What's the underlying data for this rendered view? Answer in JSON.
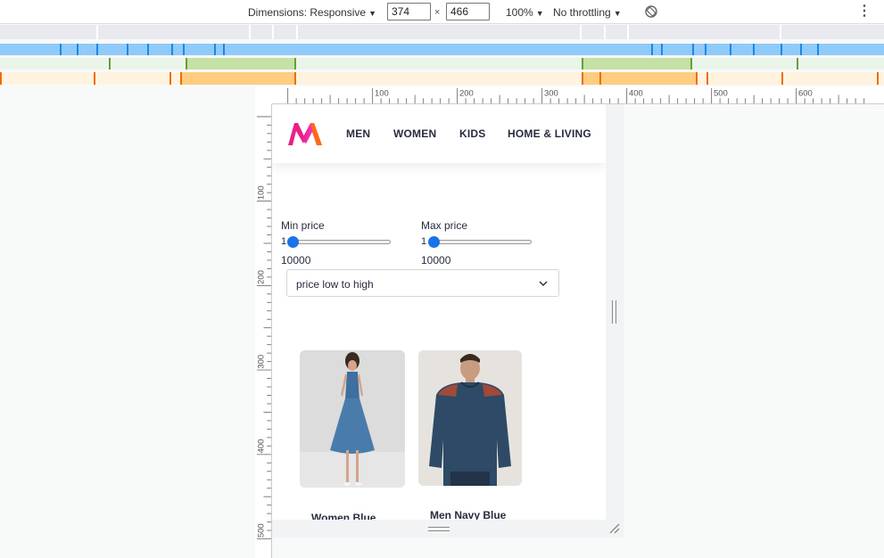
{
  "devtools": {
    "dimensions_label": "Dimensions: Responsive",
    "width_value": "374",
    "times": "×",
    "height_value": "466",
    "zoom_label": "100%",
    "throttle_label": "No throttling",
    "caret": "▼",
    "more": "⋮",
    "ruler_h_labels": [
      "100",
      "200",
      "300",
      "400",
      "500",
      "600"
    ],
    "ruler_v_labels": [
      "100",
      "200",
      "300",
      "400",
      "500"
    ]
  },
  "site": {
    "nav": {
      "links": [
        "MEN",
        "WOMEN",
        "KIDS",
        "HOME & LIVING"
      ]
    },
    "filters": {
      "min_label": "Min price",
      "min_value": "1",
      "min_current": "10000",
      "max_label": "Max price",
      "max_value": "1",
      "max_current": "10000",
      "slider_min_position": 0,
      "slider_max_position": 0
    },
    "sort": {
      "selected": "price low to high"
    },
    "products": [
      {
        "name": "Women Blue"
      },
      {
        "name": "Men Navy Blue"
      }
    ]
  },
  "colors": {
    "brand_pink": "#e91e8c",
    "brand_orange": "#ff6a13",
    "accent_blue": "#1a73e8",
    "mq_blue": "#90caf9",
    "mq_green": "#c5e1a5",
    "mq_orange": "#ffcc80"
  }
}
